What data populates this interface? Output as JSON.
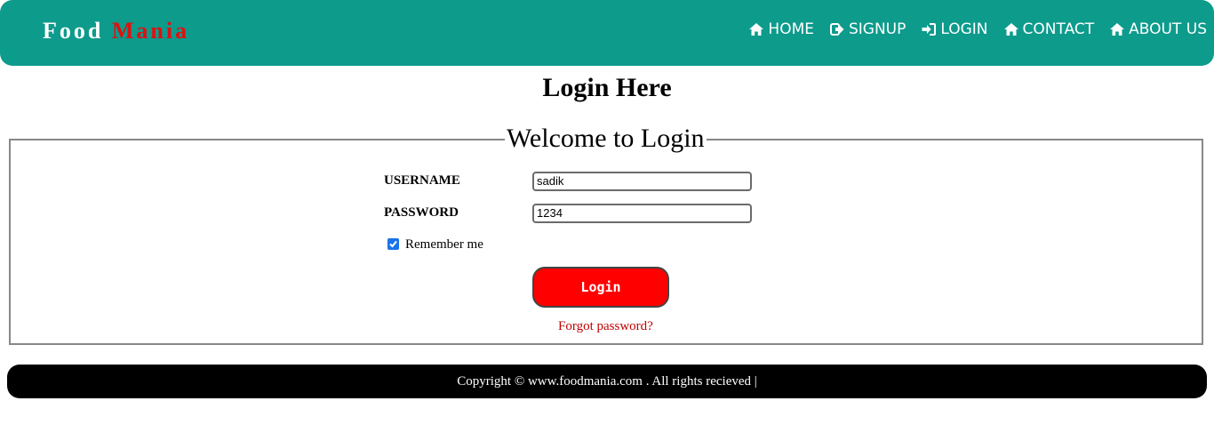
{
  "brand": {
    "first": "Food",
    "second": "Mania"
  },
  "nav": [
    {
      "icon": "home-icon",
      "label": "HOME"
    },
    {
      "icon": "signup-icon",
      "label": "SIGNUP"
    },
    {
      "icon": "login-icon",
      "label": "LOGIN"
    },
    {
      "icon": "home-icon",
      "label": "CONTACT"
    },
    {
      "icon": "home-icon",
      "label": "ABOUT US"
    }
  ],
  "page": {
    "title": "Login Here"
  },
  "form": {
    "legend": "Welcome to Login",
    "username_label": "USERNAME",
    "username_value": "sadik",
    "password_label": "PASSWORD",
    "password_value": "1234",
    "remember_label": "Remember me",
    "remember_checked": true,
    "login_button": "Login",
    "forgot_link": "Forgot password?"
  },
  "footer": {
    "text": "Copyright © www.foodmania.com . All rights recieved |"
  },
  "colors": {
    "navbar": "#0d9b8c",
    "brand_accent": "#e01010",
    "button": "#ff0000",
    "link": "#c00000",
    "footer": "#000000"
  }
}
